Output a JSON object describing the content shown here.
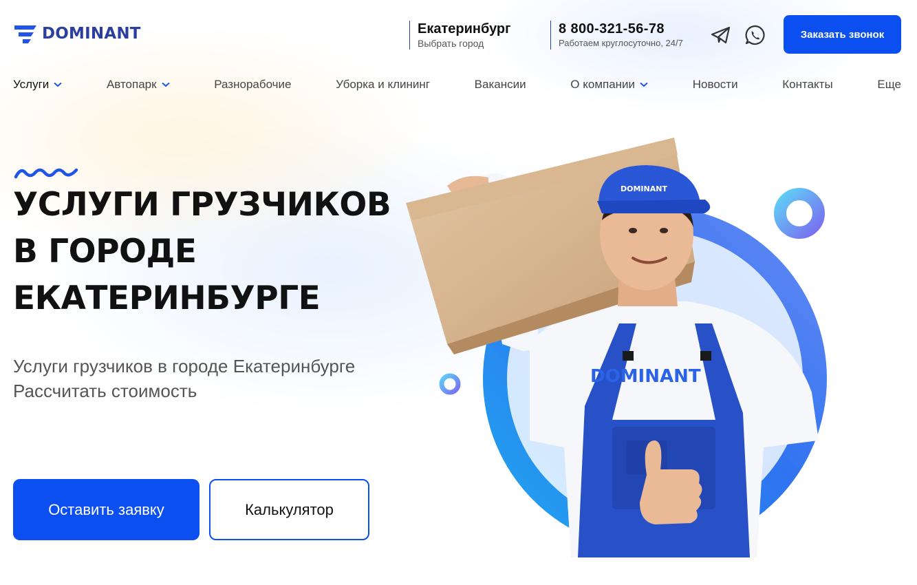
{
  "brand": {
    "name": "DOMINANT",
    "color": "#2b3fa0",
    "accent": "#0b4ff0"
  },
  "header": {
    "city": {
      "name": "Екатеринбург",
      "hint": "Выбрать город"
    },
    "phone": {
      "number": "8 800-321-56-78",
      "hours": "Работаем круглосуточно, 24/7"
    },
    "social": [
      "telegram-icon",
      "whatsapp-icon"
    ],
    "callback_label": "Заказать звонок"
  },
  "nav": {
    "items": [
      {
        "label": "Услуги",
        "dropdown": true,
        "active": true
      },
      {
        "label": "Автопарк",
        "dropdown": true
      },
      {
        "label": "Разнорабочие"
      },
      {
        "label": "Уборка и клининг"
      },
      {
        "label": "Вакансии"
      },
      {
        "label": "О компании",
        "dropdown": true
      },
      {
        "label": "Новости"
      },
      {
        "label": "Контакты"
      },
      {
        "label": "Еще"
      }
    ]
  },
  "hero": {
    "title_lines": [
      "УСЛУГИ ГРУЗЧИКОВ",
      "В ГОРОДЕ",
      "ЕКАТЕРИНБУРГЕ"
    ],
    "subtitle_lines": [
      "Услуги грузчиков в городе Екатеринбурге",
      "Рассчитать стоимость"
    ],
    "primary_button": "Оставить заявку",
    "secondary_button": "Калькулятор",
    "image": {
      "cap_text": "DOMINANT",
      "shirt_text": "DOMINANT"
    }
  }
}
